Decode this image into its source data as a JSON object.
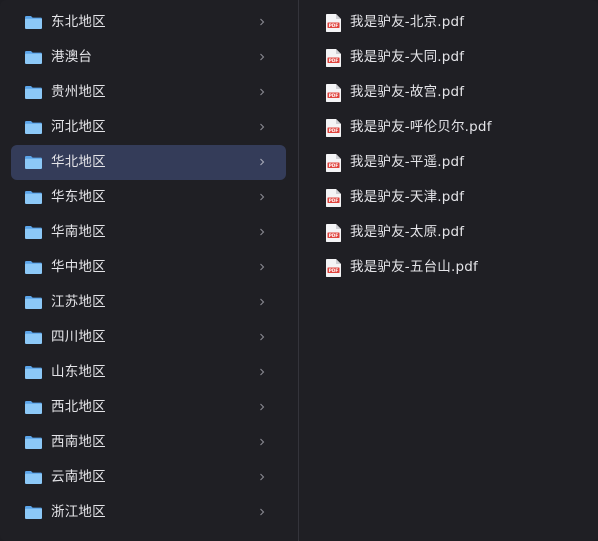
{
  "colors": {
    "background": "#1f1f24",
    "selected_row": "#343c59",
    "text": "#e4e4e8",
    "folder_blue": "#6fb3f0",
    "pdf_red": "#e0443e"
  },
  "folders": [
    {
      "label": "东北地区",
      "icon": "folder-icon",
      "selected": false
    },
    {
      "label": "港澳台",
      "icon": "folder-icon",
      "selected": false
    },
    {
      "label": "贵州地区",
      "icon": "folder-icon",
      "selected": false
    },
    {
      "label": "河北地区",
      "icon": "folder-icon",
      "selected": false
    },
    {
      "label": "华北地区",
      "icon": "folder-icon",
      "selected": true
    },
    {
      "label": "华东地区",
      "icon": "folder-icon",
      "selected": false
    },
    {
      "label": "华南地区",
      "icon": "folder-icon",
      "selected": false
    },
    {
      "label": "华中地区",
      "icon": "folder-icon",
      "selected": false
    },
    {
      "label": "江苏地区",
      "icon": "folder-icon",
      "selected": false
    },
    {
      "label": "四川地区",
      "icon": "folder-icon",
      "selected": false
    },
    {
      "label": "山东地区",
      "icon": "folder-icon",
      "selected": false
    },
    {
      "label": "西北地区",
      "icon": "folder-icon",
      "selected": false
    },
    {
      "label": "西南地区",
      "icon": "folder-icon",
      "selected": false
    },
    {
      "label": "云南地区",
      "icon": "folder-icon",
      "selected": false
    },
    {
      "label": "浙江地区",
      "icon": "folder-icon",
      "selected": false
    }
  ],
  "files": [
    {
      "label": "我是驴友-北京.pdf",
      "icon": "pdf-icon"
    },
    {
      "label": "我是驴友-大同.pdf",
      "icon": "pdf-icon"
    },
    {
      "label": "我是驴友-故宫.pdf",
      "icon": "pdf-icon"
    },
    {
      "label": "我是驴友-呼伦贝尔.pdf",
      "icon": "pdf-icon"
    },
    {
      "label": "我是驴友-平遥.pdf",
      "icon": "pdf-icon"
    },
    {
      "label": "我是驴友-天津.pdf",
      "icon": "pdf-icon"
    },
    {
      "label": "我是驴友-太原.pdf",
      "icon": "pdf-icon"
    },
    {
      "label": "我是驴友-五台山.pdf",
      "icon": "pdf-icon"
    }
  ]
}
